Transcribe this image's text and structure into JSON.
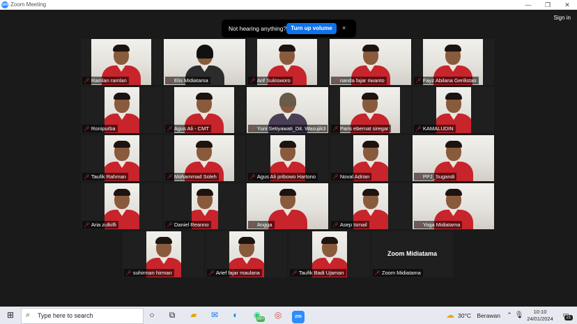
{
  "window": {
    "title": "Zoom Meeting",
    "logo": "zm",
    "controls": [
      "minimize-icon",
      "maximize-icon",
      "close-icon"
    ]
  },
  "header": {
    "sign_in": "Sign in"
  },
  "toast": {
    "message": "Not hearing anything?",
    "button": "Turn up volume",
    "close": "×"
  },
  "participants": [
    "Ramlan ramlan",
    "Elis Midiatama",
    "Arif Sukisworo",
    "nanda fajar riwanto",
    "Fayz Abilana Gerilistan",
    "Ronipurba",
    "Agus Ali - CMT",
    "Yuni Setiyawati_Dit. Wasujik3",
    "Paris ebernat siregar",
    "KAMALUDIN",
    "Taufik Rahman",
    "Mohammad Soleh",
    "Agus Ali pribowo Hartono",
    "Noval Adrian",
    "PPJ_Sugandi",
    "Aria zulkifli",
    "Daniel Reanno",
    "Angga",
    "Asep Ismail",
    "Yoga Midiatama",
    "suhirman hirman",
    "Arief fajar maulana",
    "Taufik Badi Ujaman",
    "Zoom Midiatama"
  ],
  "no_video_name": "Zoom Midiatama",
  "colors": {
    "accent": "#2D8CFF",
    "active_speaker": "#a8e05f",
    "muted": "#e0353a",
    "toast_button": "#0E72ED"
  },
  "taskbar": {
    "search_placeholder": "Type here to search",
    "whatsapp_badge": "99+",
    "weather_temp": "30°C",
    "weather_desc": "Berawan",
    "time": "10:10",
    "date": "24/01/2024",
    "notification_count": "21"
  }
}
